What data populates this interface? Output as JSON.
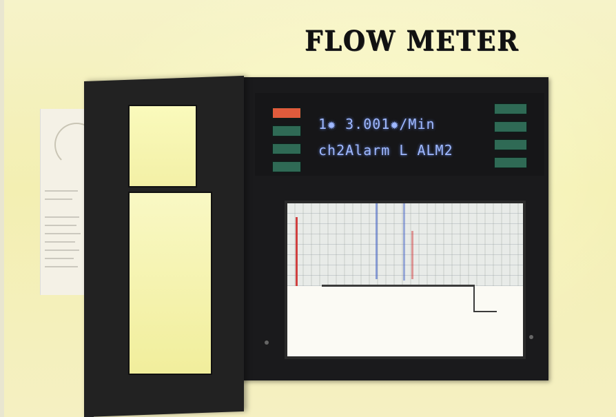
{
  "title": "FLOW METER",
  "display": {
    "line1": "1✹ 3.001✹/Min",
    "line2": "ch2Alarm L ALM2"
  },
  "panel_buttons": {
    "left": [
      "",
      "",
      "",
      ""
    ],
    "right": [
      "",
      "",
      "",
      ""
    ]
  },
  "colors": {
    "background": "#f4f0b8",
    "cabinet": "#1a1a1c",
    "display_text": "#9fb8ff",
    "button_green": "#2f6a55",
    "button_red": "#e05b3c"
  }
}
